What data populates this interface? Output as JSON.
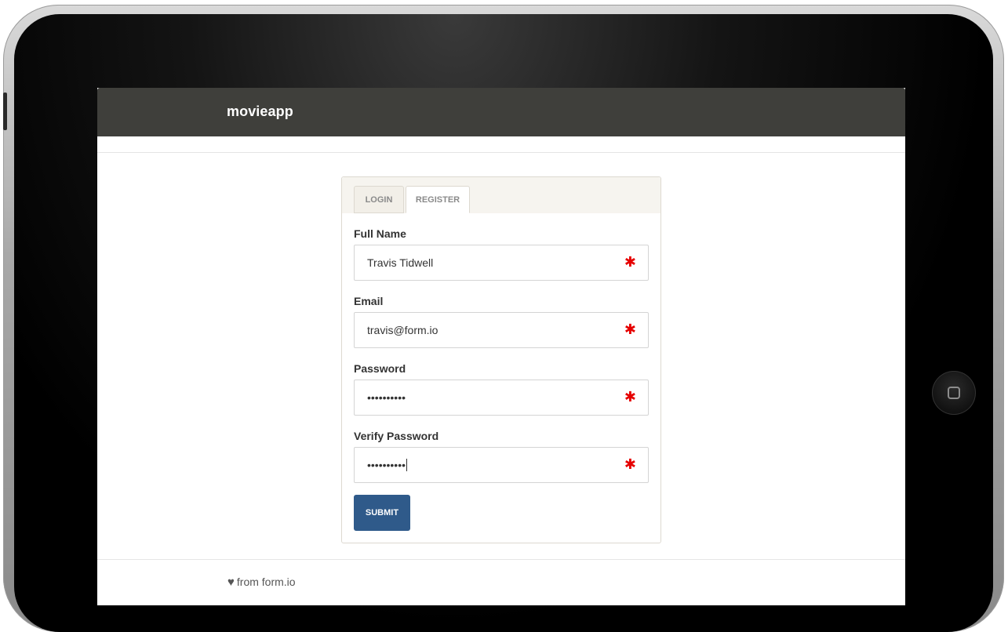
{
  "app": {
    "title": "movieapp"
  },
  "tabs": [
    {
      "label": "LOGIN",
      "active": false
    },
    {
      "label": "REGISTER",
      "active": true
    }
  ],
  "form": {
    "fields": [
      {
        "label": "Full Name",
        "value": "Travis Tidwell",
        "required": true
      },
      {
        "label": "Email",
        "value": "travis@form.io",
        "required": true
      },
      {
        "label": "Password",
        "value": "••••••••••",
        "required": true
      },
      {
        "label": "Verify Password",
        "value": "••••••••••",
        "required": true
      }
    ],
    "required_marker": "✱",
    "submit_label": "SUBMIT"
  },
  "footer": {
    "heart_icon": "♥",
    "text": "from form.io"
  },
  "colors": {
    "navbar": "#3f3f3b",
    "submit": "#2f5a8a",
    "required": "#e60000",
    "panel_header": "#f6f4ef"
  }
}
